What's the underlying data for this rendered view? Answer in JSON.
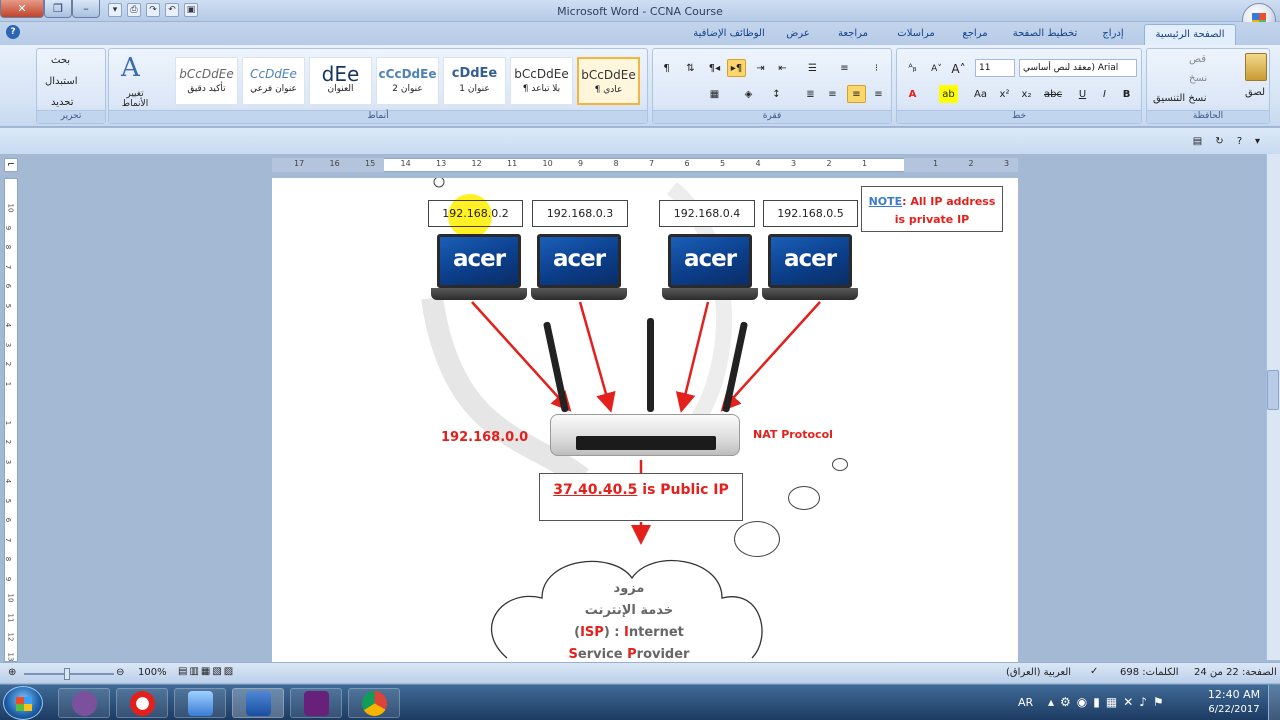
{
  "window": {
    "title": "Microsoft Word - CCNA  Course",
    "help": "?"
  },
  "tabs": [
    "الصفحة الرئيسية",
    "إدراج",
    "تخطيط الصفحة",
    "مراجع",
    "مراسلات",
    "مراجعة",
    "عرض",
    "الوظائف الإضافية"
  ],
  "clipboard": {
    "paste": "لصق",
    "cut": "قص",
    "copy": "نسخ",
    "format_painter": "نسخ التنسيق",
    "label": "الحافظة"
  },
  "font": {
    "name": "معقد لنص أساسي) Arial",
    "size": "11",
    "label": "خط"
  },
  "paragraph": {
    "label": "فقرة"
  },
  "styles": {
    "label": "أنماط",
    "change_styles": "تغيير الأنماط",
    "items": [
      {
        "preview": "bCcDdEe",
        "name": "¶ عادي"
      },
      {
        "preview": "bCcDdEe",
        "name": "¶ بلا تباعد"
      },
      {
        "preview": "cDdEe",
        "name": "عنوان 1"
      },
      {
        "preview": "cCcDdEe",
        "name": "عنوان 2"
      },
      {
        "preview": "dEe",
        "name": "العنوان"
      },
      {
        "preview": "CcDdEe",
        "name": "عنوان فرعي"
      },
      {
        "preview": "bCcDdEe",
        "name": "تأكيد دقيق"
      }
    ]
  },
  "editing": {
    "find": "بحث",
    "replace": "استبدال",
    "select": "تحديد",
    "label": "تحرير"
  },
  "ruler": {
    "h": [
      "17",
      "16",
      "15",
      "14",
      "13",
      "12",
      "11",
      "10",
      "9",
      "8",
      "7",
      "6",
      "5",
      "4",
      "3",
      "2",
      "1",
      "",
      "1",
      "2",
      "3"
    ],
    "v": [
      "10",
      "9",
      "8",
      "7",
      "6",
      "5",
      "4",
      "3",
      "2",
      "1",
      "",
      "1",
      "2",
      "3",
      "4",
      "5",
      "6",
      "7",
      "8",
      "9",
      "10",
      "11",
      "12",
      "13"
    ]
  },
  "diagram": {
    "ips": [
      "192.168.0.2",
      "192.168.0.3",
      "192.168.0.4",
      "192.168.0.5"
    ],
    "laptop_brand": "acer",
    "note_label": "NOTE",
    "note_text1": ":  All IP address",
    "note_text2": "is private IP",
    "router_ip": "192.168.0.0",
    "nat": "NAT Protocol",
    "public_ip": "37.40.40.5",
    "public_suffix": " is Public IP",
    "isp_line1": "مزود",
    "isp_line2": "خدمة الإنترنت",
    "isp_line3a": "(",
    "isp_line3b": "ISP",
    "isp_line3c": ") : ",
    "isp_line3d": "I",
    "isp_line3e": "nternet",
    "isp_line4a": "S",
    "isp_line4b": "ervice ",
    "isp_line4c": "P",
    "isp_line4d": "rovider"
  },
  "statusbar": {
    "page": "الصفحة: 22 من 24",
    "words": "الكلمات: 698",
    "language": "العربية (العراق)",
    "zoom": "100%"
  },
  "taskbar": {
    "lang": "AR",
    "time": "12:40 AM",
    "date": "6/22/2017"
  }
}
